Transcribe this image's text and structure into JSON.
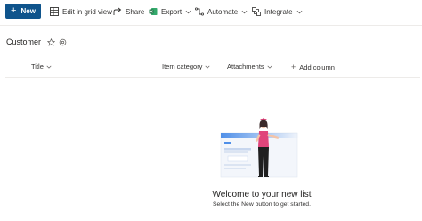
{
  "toolbar": {
    "new_label": "New",
    "edit_grid_label": "Edit in grid view",
    "share_label": "Share",
    "export_label": "Export",
    "automate_label": "Automate",
    "integrate_label": "Integrate",
    "more_label": "···"
  },
  "list": {
    "title": "Customer"
  },
  "columns": {
    "title": "Title",
    "item_category": "Item category",
    "attachments": "Attachments",
    "add_column": "Add column"
  },
  "empty_state": {
    "heading": "Welcome to your new list",
    "subtext": "Select the New button to get started."
  },
  "icons": {
    "new": "plus-icon",
    "edit_grid": "grid-icon",
    "share": "share-icon",
    "export": "excel-icon",
    "automate": "flow-icon",
    "integrate": "integrate-icon",
    "favorite": "star-icon",
    "settings": "settings-icon"
  },
  "colors": {
    "primary": "#0f548c",
    "excel_green": "#217346",
    "illustration_blue": "#4f8fe8",
    "illustration_pink": "#e0457b"
  }
}
